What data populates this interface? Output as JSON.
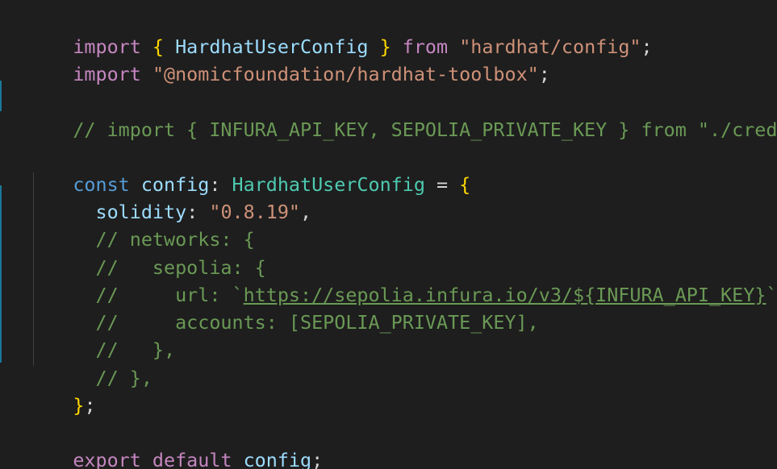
{
  "editor": {
    "lines": {
      "l1": {
        "import_kw": "import",
        "brace_open": " { ",
        "name": "HardhatUserConfig",
        "brace_close": " } ",
        "from_kw": "from",
        "space": " ",
        "module": "\"hardhat/config\"",
        "semi": ";"
      },
      "l2": {
        "import_kw": "import",
        "space": " ",
        "module": "\"@nomicfoundation/hardhat-toolbox\"",
        "semi": ";"
      },
      "l4": {
        "comment": "// import { INFURA_API_KEY, SEPOLIA_PRIVATE_KEY } from \"./cred\";"
      },
      "l6": {
        "const_kw": "const",
        "name": " config",
        "colon": ": ",
        "type": "HardhatUserConfig",
        "eq": " = ",
        "brace": "{"
      },
      "l7": {
        "indent": "  ",
        "prop": "solidity",
        "colon": ": ",
        "value": "\"0.8.19\"",
        "comma": ","
      },
      "l8": {
        "comment": "  // networks: {"
      },
      "l9": {
        "comment": "  //   sepolia: {"
      },
      "l10": {
        "comment_pre": "  //     url: `",
        "url": "https://sepolia.infura.io/v3/${INFURA_API_KEY}",
        "comment_post": "`,"
      },
      "l11": {
        "comment": "  //     accounts: [SEPOLIA_PRIVATE_KEY],"
      },
      "l12": {
        "comment": "  //   },"
      },
      "l13": {
        "comment": "  // },"
      },
      "l14": {
        "brace": "}",
        "semi": ";"
      },
      "l16": {
        "export_kw": "export",
        "default_kw": " default",
        "name": " config",
        "semi": ";"
      }
    },
    "colors": {
      "background": "#1e1e1e",
      "keyword": "#569cd6",
      "control_keyword": "#c586c0",
      "string": "#ce9178",
      "comment": "#6a9955",
      "identifier": "#9cdcfe",
      "type": "#4ec9b0",
      "bracket": "#ffd700"
    }
  }
}
